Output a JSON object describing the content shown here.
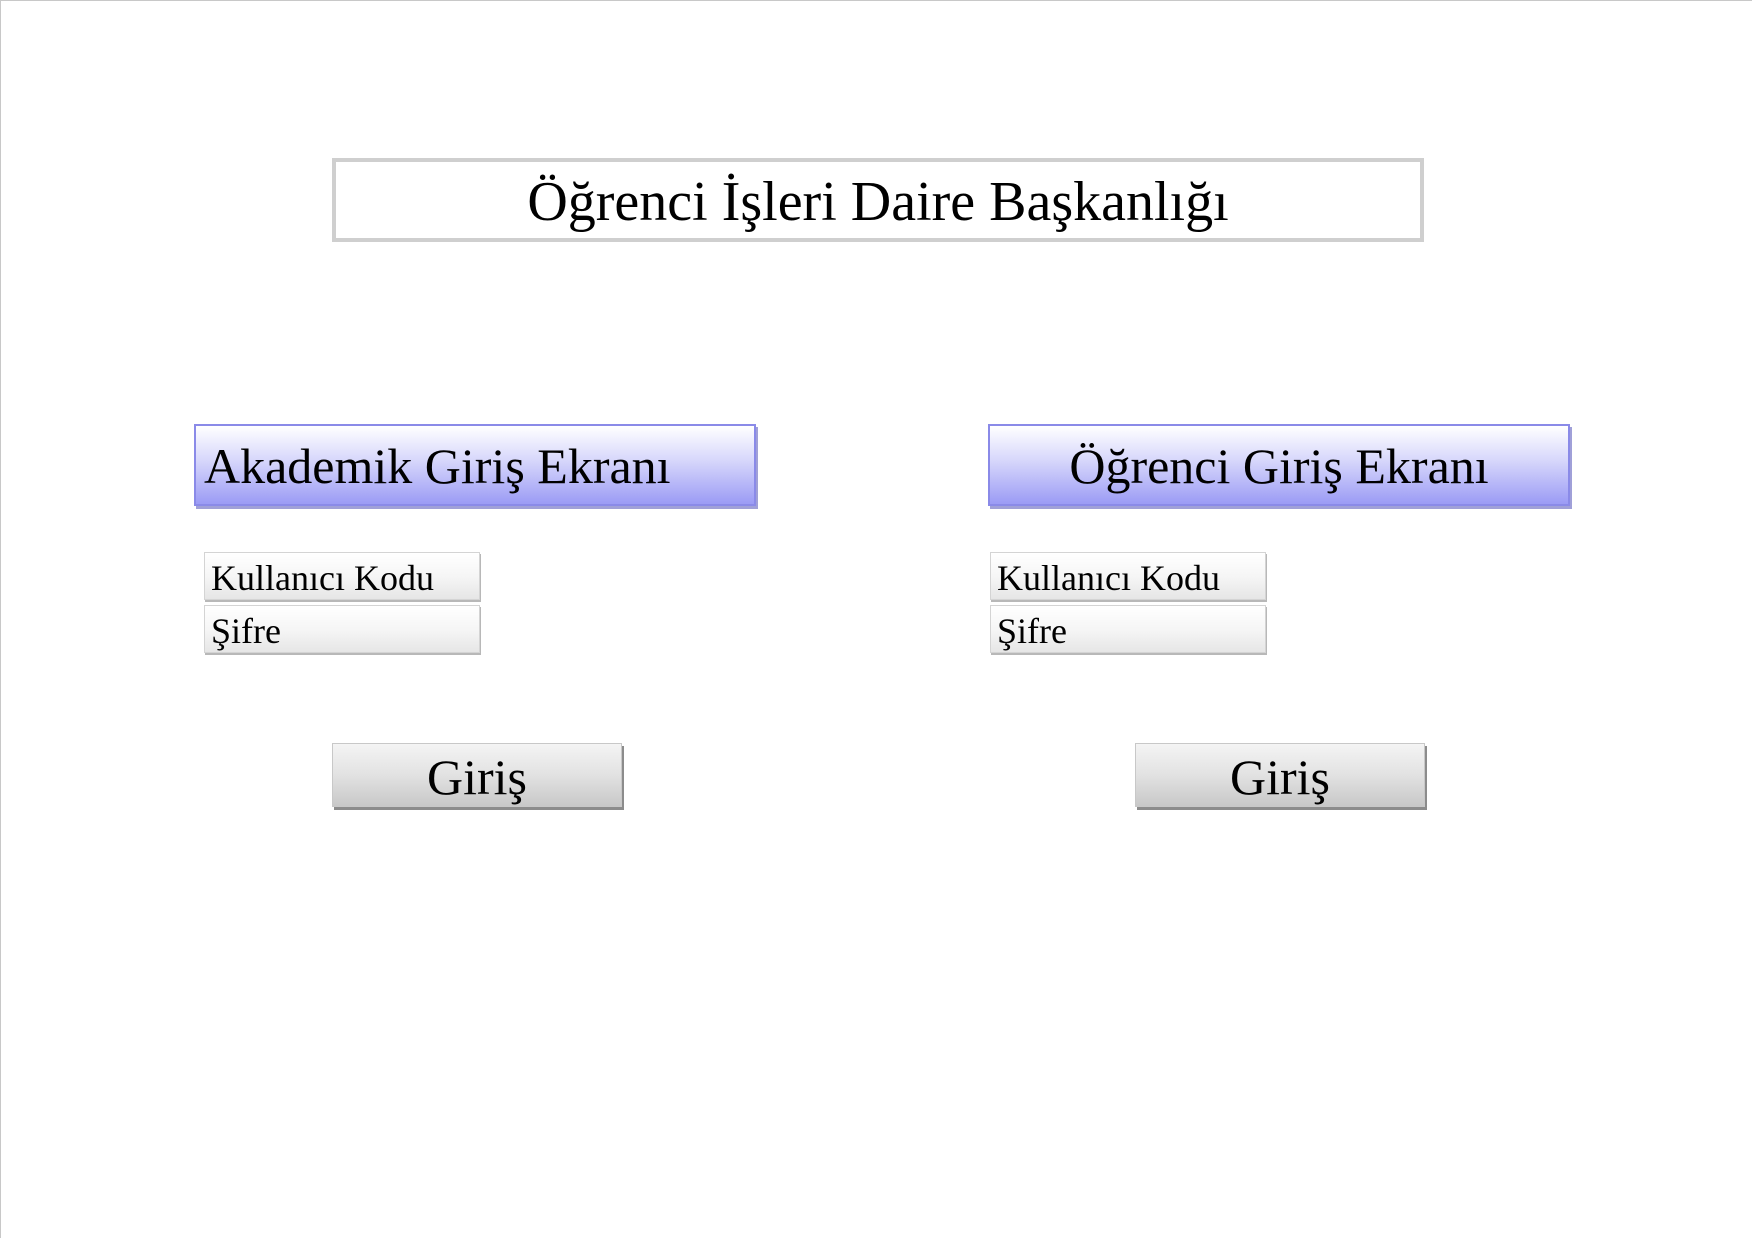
{
  "page": {
    "title": "Öğrenci İşleri Daire Başkanlığı"
  },
  "academic_panel": {
    "header": "Akademik Giriş Ekranı",
    "username_label": "Kullanıcı Kodu",
    "password_label": "Şifre",
    "login_button": "Giriş"
  },
  "student_panel": {
    "header": "Öğrenci Giriş Ekranı",
    "username_label": "Kullanıcı Kodu",
    "password_label": "Şifre",
    "login_button": "Giriş"
  },
  "colors": {
    "header_gradient_bottom": "#9b9bf5",
    "header_border": "#8a8ae8",
    "title_border": "#cfcfcf",
    "button_gray": "#c8c8c8"
  }
}
